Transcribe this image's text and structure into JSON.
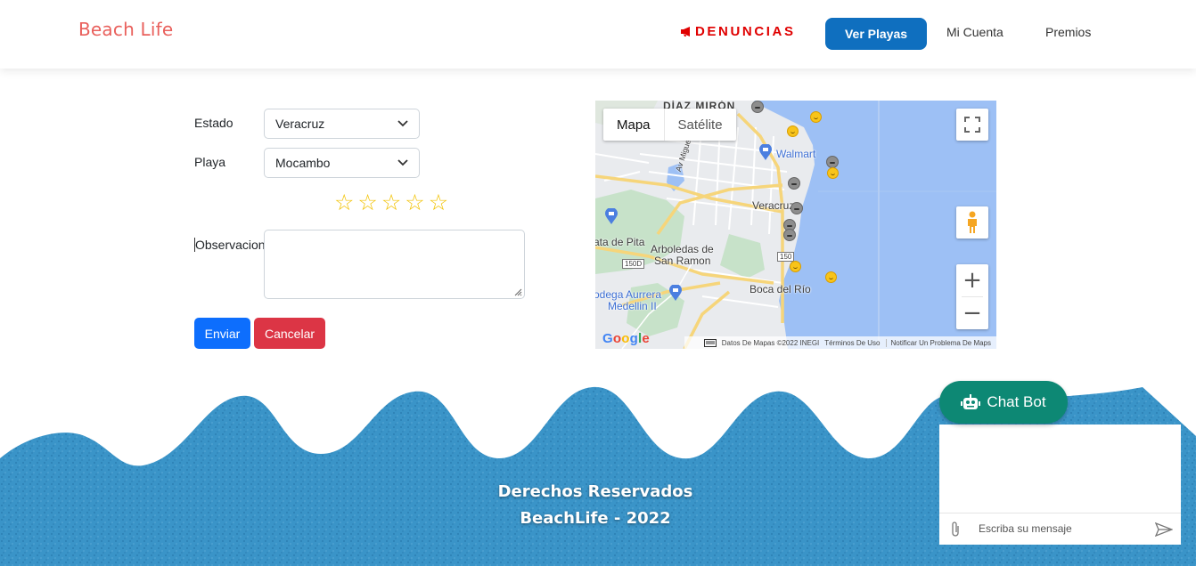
{
  "navbar": {
    "brand": "Beach Life",
    "denuncias": "DENUNCIAS",
    "ver_playas": "Ver Playas",
    "mi_cuenta": "Mi Cuenta",
    "premios": "Premios"
  },
  "form": {
    "estado_label": "Estado",
    "estado_value": "Veracruz",
    "playa_label": "Playa",
    "playa_value": "Mocambo",
    "rating": 0,
    "rating_max": 5,
    "observaciones_label": "Observacion",
    "observaciones_value": "",
    "enviar": "Enviar",
    "cancelar": "Cancelar"
  },
  "map": {
    "type_map": "Mapa",
    "type_satellite": "Satélite",
    "labels": {
      "diaz_miron": "DÍAZ MIRÓN",
      "walmart": "Walmart",
      "veracruz": "Veracruz",
      "plata_pita": "ata de Pita",
      "arboledas": "Arboledas de",
      "san_ramon": "San Ramon",
      "boca_del_rio": "Boca del Río",
      "bodega": "odega Aurrera",
      "medellin": "Medellin II",
      "av_miguel": "Av Miguel Alemán",
      "route_150d": "150D",
      "route_150": "150"
    },
    "google": "Google",
    "attribution": "Datos De Mapas ©2022 INEGI",
    "terms": "Términos De Uso",
    "report": "Notificar Un Problema De Maps"
  },
  "footer": {
    "line1": "Derechos Reservados",
    "line2": "BeachLife - 2022"
  },
  "chatbot": {
    "title": "Chat Bot",
    "placeholder": "Escriba su mensaje"
  },
  "colors": {
    "brand": "#e9605c",
    "denuncias": "#e00000",
    "primary_nav": "#0f6fbf",
    "btn_blue": "#0d6efd",
    "btn_red": "#dc3545",
    "chat_green": "#0d8874",
    "wave_blue": "#3a94c8",
    "star": "#f2c200"
  }
}
